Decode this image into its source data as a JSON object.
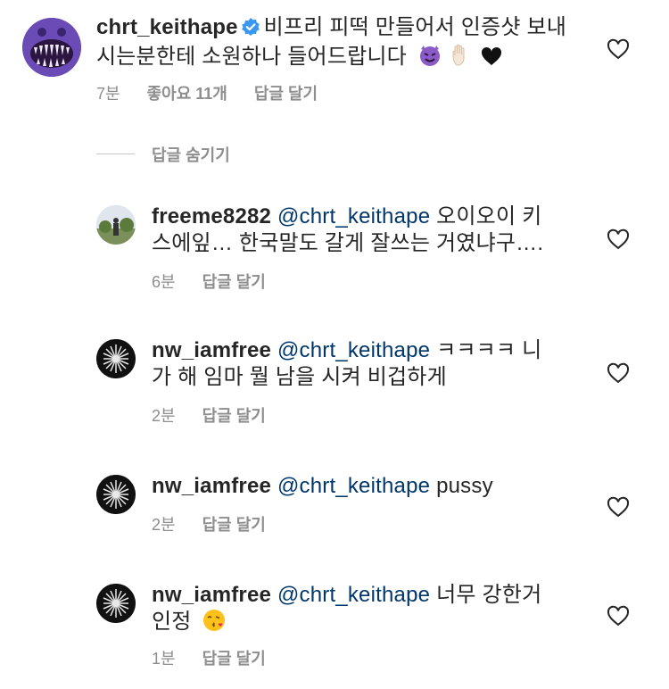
{
  "comments": [
    {
      "username": "chrt_keithape",
      "verified": true,
      "text_line1": "비프리 피떡 만들어서 인증샷 보내",
      "text_line2": "시는분한테 소원하나 들어드랍니다",
      "emojis": [
        "devil-emoji",
        "raised-hand-emoji",
        "black-heart-emoji"
      ],
      "time": "7분",
      "likes": "좋아요 11개",
      "reply": "답글 달기"
    },
    {
      "username": "freeme8282",
      "mention": "@chrt_keithape",
      "text_line1_rest": "오이오이 키",
      "text_line2": "스에잎… 한국말도 갈게 잘쓰는 거였냐구….",
      "time": "6분",
      "reply": "답글 달기"
    },
    {
      "username": "nw_iamfree",
      "mention": "@chrt_keithape",
      "text_line1_rest": "ㅋㅋㅋㅋ 니",
      "text_line2": "가 해 임마 뭘 남을 시켜 비겁하게",
      "time": "2분",
      "reply": "답글 달기"
    },
    {
      "username": "nw_iamfree",
      "mention": "@chrt_keithape",
      "text_line1_rest": "pussy",
      "time": "2분",
      "reply": "답글 달기"
    },
    {
      "username": "nw_iamfree",
      "mention": "@chrt_keithape",
      "text_line1_rest": "너무 강한거",
      "text_line2": "인정",
      "emojis": [
        "kissing-face-emoji"
      ],
      "time": "1분",
      "reply": "답글 달기"
    }
  ],
  "hide_replies_label": "답글 숨기기",
  "colors": {
    "verified": "#3897f0",
    "mention": "#00376b",
    "meta": "#8e8e8e"
  }
}
